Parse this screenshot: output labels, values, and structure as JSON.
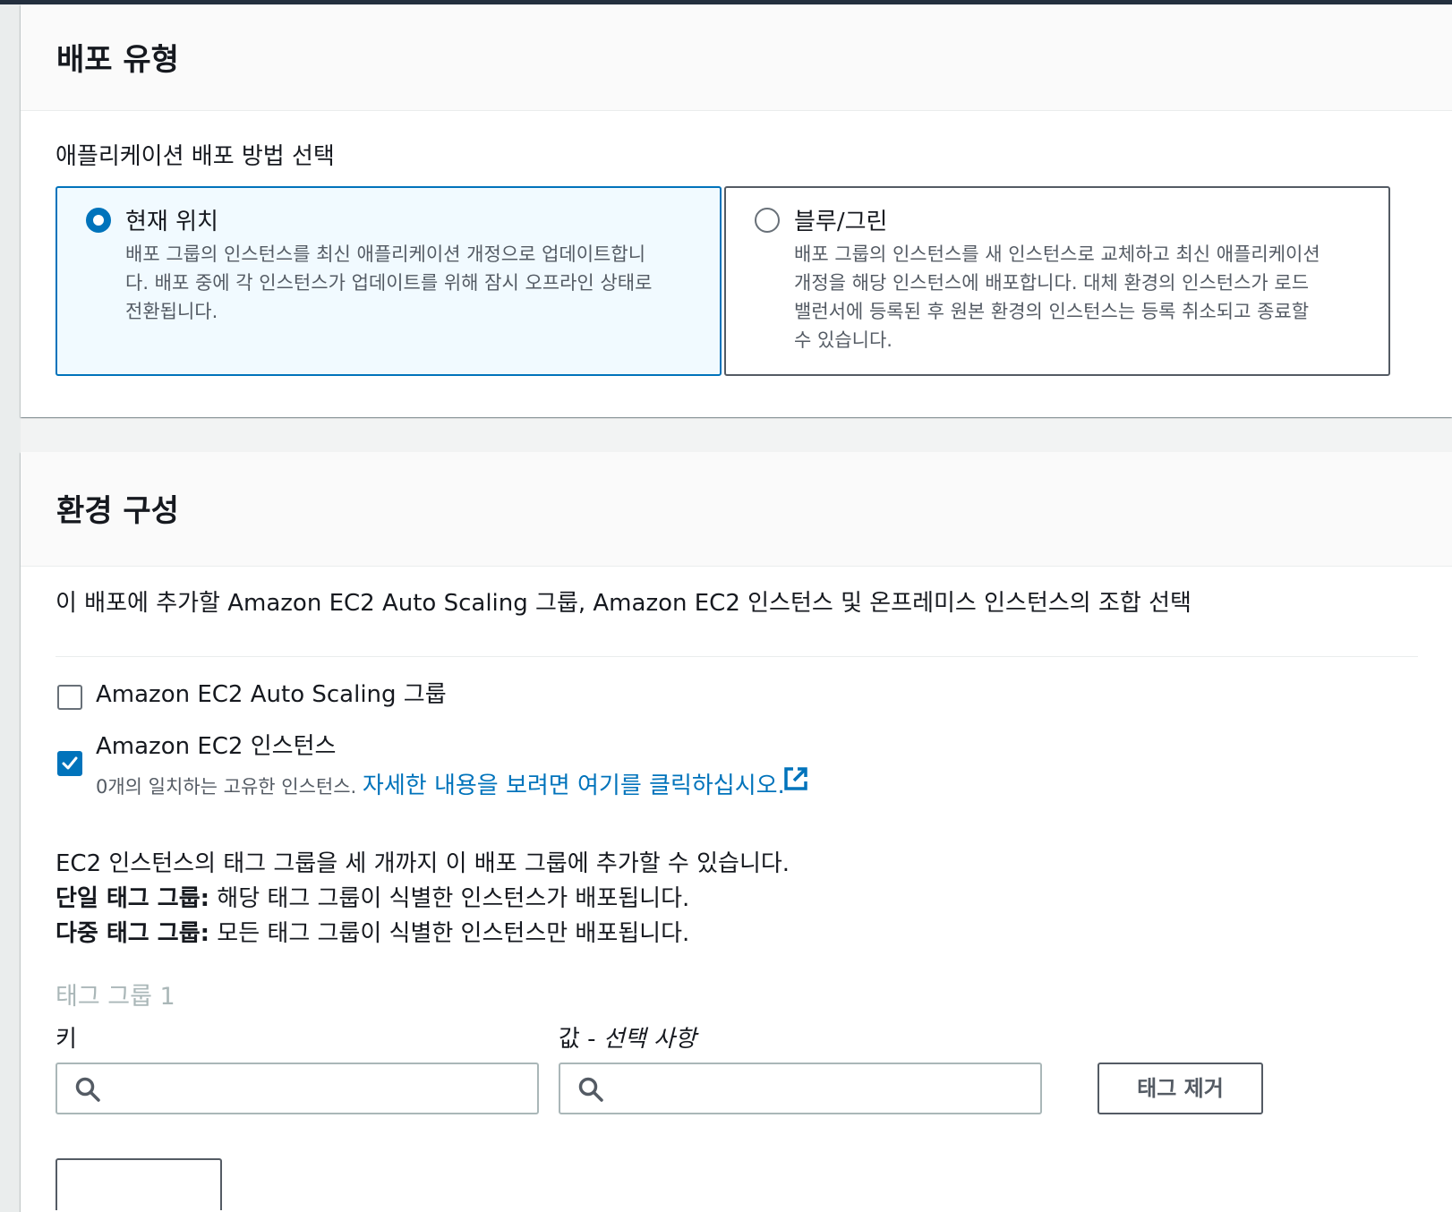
{
  "deployment_type": {
    "title": "배포 유형",
    "prompt": "애플리케이션 배포 방법 선택",
    "options": [
      {
        "label": "현재 위치",
        "description_lines": [
          "배포 그룹의 인스턴스를 최신 애플리케이션 개정으로 업데이트합니",
          "다. 배포 중에 각 인스턴스가 업데이트를 위해 잠시 오프라인 상태로",
          "전환됩니다."
        ],
        "selected": true
      },
      {
        "label": "블루/그린",
        "description_lines": [
          "배포 그룹의 인스턴스를 새 인스턴스로 교체하고 최신 애플리케이션",
          "개정을 해당 인스턴스에 배포합니다. 대체 환경의 인스턴스가 로드",
          "밸런서에 등록된 후 원본 환경의 인스턴스는 등록 취소되고 종료할",
          "수 있습니다."
        ],
        "selected": false
      }
    ]
  },
  "environment": {
    "title": "환경 구성",
    "prompt": "이 배포에 추가할 Amazon EC2 Auto Scaling 그룹, Amazon EC2 인스턴스 및 온프레미스 인스턴스의 조합 선택",
    "options": [
      {
        "label": "Amazon EC2 Auto Scaling 그룹",
        "checked": false
      },
      {
        "label": "Amazon EC2 인스턴스",
        "checked": true
      }
    ],
    "match_text": "0개의 일치하는 고유한 인스턴스.",
    "match_link": "자세한 내용을 보려면 여기를 클릭하십시오.",
    "info_line1": "EC2 인스턴스의 태그 그룹을 세 개까지 이 배포 그룹에 추가할 수 있습니다.",
    "info_single_bold": "단일 태그 그룹:",
    "info_single_rest": " 해당 태그 그룹이 식별한 인스턴스가 배포됩니다.",
    "info_multi_bold": "다중 태그 그룹:",
    "info_multi_rest": " 모든 태그 그룹이 식별한 인스턴스만 배포됩니다.",
    "tag_group_label": "태그 그룹 1",
    "key_label": "키",
    "value_label_prefix": "값 - ",
    "value_label_optional": "선택 사항",
    "key_input": {
      "value": "",
      "placeholder": ""
    },
    "value_input": {
      "value": "",
      "placeholder": ""
    },
    "remove_tag_button": "태그 제거"
  },
  "icons": {
    "search": "search-icon",
    "external_link": "external-link-icon",
    "check": "check-icon"
  },
  "colors": {
    "accent": "#0073bb",
    "selected_tile_bg": "#f1faff",
    "topbar": "#232f3e",
    "text": "#16191f",
    "secondary_text": "#545b64"
  }
}
